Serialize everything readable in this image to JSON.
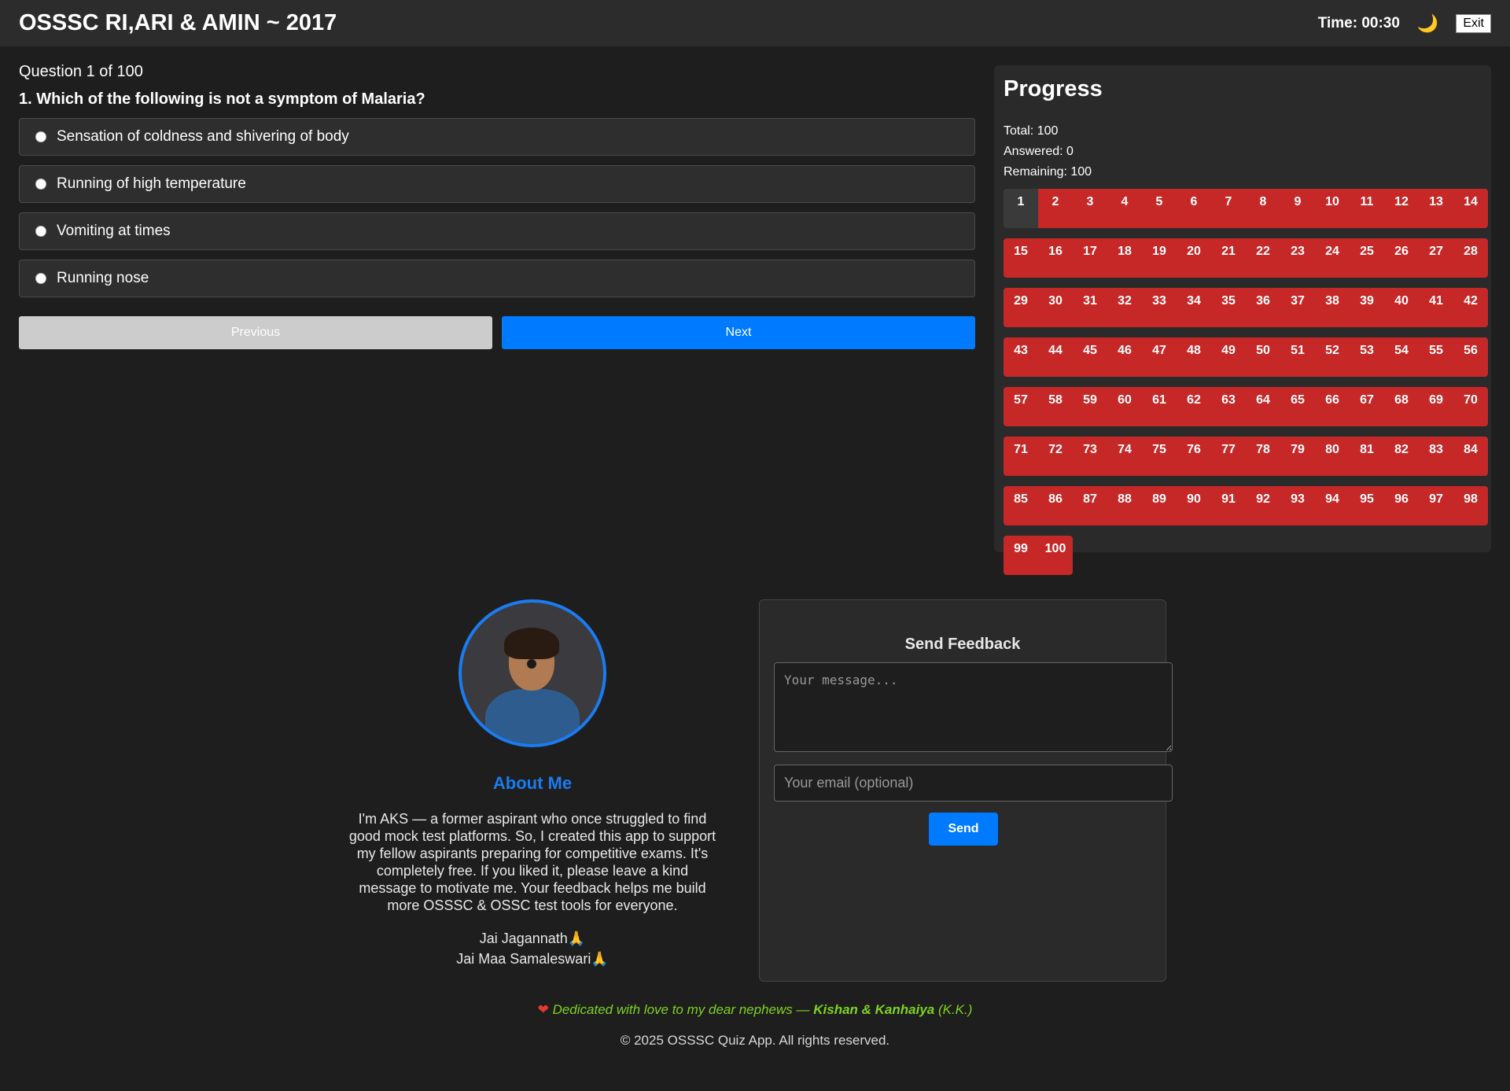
{
  "header": {
    "title": "OSSSC RI,ARI & AMIN ~ 2017",
    "timer": "Time: 00:30",
    "theme_icon": "crescent-moon-icon",
    "exit_label": "Exit"
  },
  "question": {
    "counter": "Question 1 of 100",
    "text": "1. Which of the following is not a symptom of Malaria?",
    "options": [
      "Sensation of coldness and shivering of body",
      "Running of high temperature",
      "Vomiting at times",
      "Running nose"
    ],
    "prev_label": "Previous",
    "next_label": "Next"
  },
  "progress": {
    "title": "Progress",
    "total": "Total: 100",
    "answered": "Answered: 0",
    "remaining": "Remaining: 100",
    "current": 1,
    "count": 100,
    "colors": {
      "unanswered": "#c62828",
      "current": "#3a3a3a"
    }
  },
  "about": {
    "heading": "About Me",
    "text": "I'm AKS — a former aspirant who once struggled to find good mock test platforms. So, I created this app to support my fellow aspirants preparing for competitive exams. It's completely free. If you liked it, please leave a kind message to motivate me. Your feedback helps me build more OSSSC & OSSC test tools for everyone.",
    "line1": "Jai Jagannath",
    "line2": "Jai Maa Samaleswari",
    "pray_icon": "🙏"
  },
  "feedback": {
    "heading": "Send Feedback",
    "message_placeholder": "Your message...",
    "email_placeholder": "Your email (optional)",
    "send_label": "Send"
  },
  "footer": {
    "heart": "❤",
    "dedication_prefix": "Dedicated with love to my dear nephews — ",
    "names": "Kishan & Kanhaiya",
    "suffix": " (K.K.)",
    "copyright": "© 2025 OSSSC Quiz App. All rights reserved."
  },
  "colors": {
    "accent": "#007bff",
    "background": "#1e1e1e",
    "dedication": "#7ed321"
  }
}
